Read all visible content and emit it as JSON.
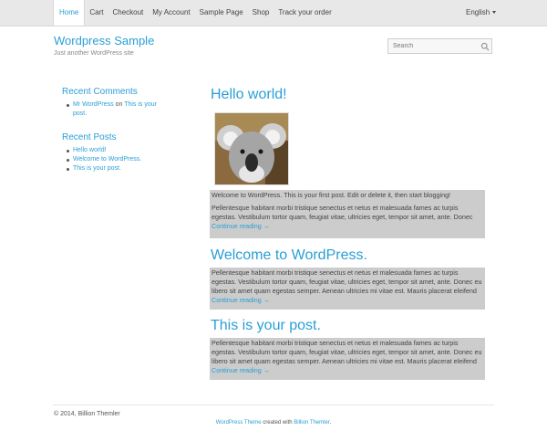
{
  "nav": {
    "items": [
      "Home",
      "Cart",
      "Checkout",
      "My Account",
      "Sample Page",
      "Shop",
      "Track your order"
    ],
    "language": "English"
  },
  "header": {
    "title": "Wordpress Sample",
    "tagline": "Just another WordPress site",
    "search_placeholder": "Search"
  },
  "sidebar": {
    "recent_comments": {
      "title": "Recent Comments",
      "author": "Mr WordPress",
      "connector": "on",
      "post_line1": "This is your",
      "post_line2": "post."
    },
    "recent_posts": {
      "title": "Recent Posts",
      "items": [
        "Hello world!",
        "Welcome to WordPress.",
        "This is your post."
      ]
    }
  },
  "posts": [
    {
      "title": "Hello world!",
      "intro": "Welcome to WordPress. This is your first post. Edit or delete it, then start blogging!",
      "excerpt": "Pellentesque habitant morbi tristique senectus et netus et malesuada fames ac turpis egestas. Vestibulum tortor quam, feugiat vitae, ultricies eget, tempor sit amet, ante. Donec",
      "more": "Continue reading →"
    },
    {
      "title": "Welcome to WordPress.",
      "excerpt": "Pellentesque habitant morbi tristique senectus et netus et malesuada fames ac turpis egestas. Vestibulum tortor quam, feugiat vitae, ultricies eget, tempor sit amet, ante. Donec eu libero sit amet quam egestas semper. Aenean ultricies mi vitae est. Mauris placerat eleifend",
      "more": "Continue reading →"
    },
    {
      "title": "This is your post.",
      "excerpt": "Pellentesque habitant morbi tristique senectus et netus et malesuada fames ac turpis egestas. Vestibulum tortor quam, feugiat vitae, ultricies eget, tempor sit amet, ante. Donec eu libero sit amet quam egestas semper. Aenean ultricies mi vitae est. Mauris placerat eleifend",
      "more": "Continue reading →"
    }
  ],
  "footer": {
    "copyright": "© 2014, Billion Themler",
    "credit_link1": "WordPress Theme",
    "credit_text": "created with",
    "credit_link2": "Billion Themler",
    "credit_end": "."
  },
  "colors": {
    "accent": "#2a9fd6",
    "nav_bg": "#e8e8e8",
    "post_bg": "#cccccc"
  }
}
